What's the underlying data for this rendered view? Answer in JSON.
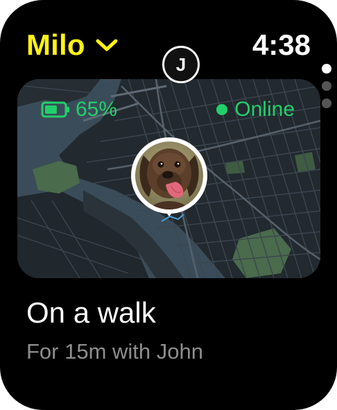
{
  "header": {
    "pet_name": "Milo",
    "time": "4:38"
  },
  "pager": {
    "page_count": 3,
    "active_index": 0
  },
  "map": {
    "battery": {
      "percent": "65%",
      "level": 0.65,
      "icon": "battery-icon"
    },
    "connection": {
      "status": "Online",
      "icon": "online-dot-icon"
    },
    "walker_initial": "J"
  },
  "activity": {
    "title": "On a walk",
    "subtitle": "For 15m with John"
  },
  "colors": {
    "accent_yellow": "#FFF212",
    "status_green": "#22D06A",
    "background": "#000000",
    "secondary_text": "#8e8e8e",
    "map_water": "#3a4c59",
    "map_land": "#22292f",
    "map_park": "#4a6b4c"
  }
}
